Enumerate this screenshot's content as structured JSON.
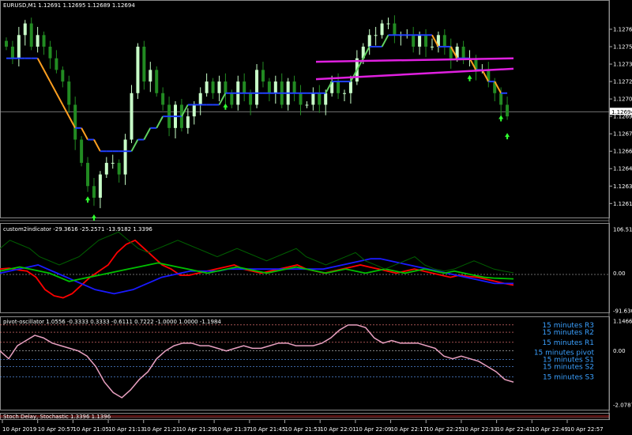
{
  "chart_data": [
    {
      "type": "candlestick",
      "title": "EURUSD,M1  1.12691 1.12695 1.12689 1.12694",
      "y_ticks": [
        "1.12765",
        "1.12750",
        "1.12735",
        "1.12720",
        "1.12705",
        "1.12690",
        "1.12675",
        "1.12660",
        "1.12645",
        "1.12630",
        "1.12615"
      ],
      "ylim": [
        1.12605,
        1.12782
      ],
      "price_label": "1.12694",
      "price_value": 1.12694,
      "closes": [
        1.1275,
        1.1274,
        1.1276,
        1.1277,
        1.1275,
        1.1276,
        1.1275,
        1.1274,
        1.1273,
        1.1272,
        1.127,
        1.1267,
        1.1265,
        1.1263,
        1.1262,
        1.1264,
        1.1265,
        1.1265,
        1.1264,
        1.1267,
        1.1271,
        1.1275,
        1.1272,
        1.1273,
        1.1271,
        1.127,
        1.1268,
        1.127,
        1.1268,
        1.1269,
        1.127,
        1.1271,
        1.1272,
        1.1271,
        1.1272,
        1.1271,
        1.127,
        1.1272,
        1.1271,
        1.127,
        1.1273,
        1.1272,
        1.1271,
        1.1272,
        1.127,
        1.1272,
        1.1271,
        1.127,
        1.127,
        1.1271,
        1.127,
        1.1271,
        1.1272,
        1.1271,
        1.1271,
        1.1272,
        1.1274,
        1.1275,
        1.1276,
        1.1276,
        1.1277,
        1.1277,
        1.1276,
        1.1276,
        1.1276,
        1.1275,
        1.1276,
        1.1275,
        1.1275,
        1.1276,
        1.1275,
        1.1274,
        1.1275,
        1.1274,
        1.1274,
        1.1273,
        1.1273,
        1.1272,
        1.1271,
        1.127,
        1.1269
      ],
      "ma_fast": [
        1.1274,
        1.1274,
        1.1274,
        1.1274,
        1.1274,
        1.1274,
        1.1273,
        1.1272,
        1.1271,
        1.127,
        1.1269,
        1.1268,
        1.1268,
        1.1267,
        1.1267,
        1.1266,
        1.1266,
        1.1266,
        1.1266,
        1.1266,
        1.1266,
        1.1267,
        1.1267,
        1.1268,
        1.1268,
        1.1269,
        1.1269,
        1.1269,
        1.1269,
        1.127,
        1.127,
        1.127,
        1.127,
        1.127,
        1.127,
        1.1271,
        1.1271,
        1.1271,
        1.1271,
        1.1271,
        1.1271,
        1.1271,
        1.1271,
        1.1271,
        1.1271,
        1.1271,
        1.1271,
        1.1271,
        1.1271,
        1.1271,
        1.1271,
        1.1271,
        1.1272,
        1.1272,
        1.1272,
        1.1272,
        1.1273,
        1.1274,
        1.1275,
        1.1275,
        1.1275,
        1.1276,
        1.1276,
        1.1276,
        1.1276,
        1.1276,
        1.1276,
        1.1276,
        1.1276,
        1.1275,
        1.1275,
        1.1275,
        1.1274,
        1.1274,
        1.1274,
        1.1273,
        1.1273,
        1.1272,
        1.1272,
        1.1271,
        1.1271
      ],
      "channel_upper": [
        1.12737,
        1.1274
      ],
      "channel_lower": [
        1.12722,
        1.12731
      ],
      "up_arrows": 6
    },
    {
      "type": "line",
      "title": "custom2indicator -29.3616 -25.2571 -13.9182 1.3396",
      "y_ticks": [
        "106.514",
        "0.00",
        "-91.6304"
      ],
      "ylim": [
        -91.6304,
        106.514
      ],
      "series": [
        {
          "color": "#ff0000",
          "values": [
            10,
            12,
            8,
            5,
            -10,
            -40,
            -55,
            -60,
            -50,
            -30,
            -10,
            5,
            20,
            50,
            70,
            80,
            60,
            40,
            20,
            10,
            -5,
            -5,
            0,
            5,
            10,
            15,
            20,
            10,
            5,
            0,
            5,
            10,
            15,
            20,
            10,
            5,
            0,
            5,
            10,
            15,
            20,
            15,
            10,
            5,
            0,
            5,
            10,
            5,
            0,
            -5,
            -10,
            -5,
            -8,
            -10,
            -15,
            -20,
            -25,
            -29
          ]
        },
        {
          "color": "#1a1aff",
          "values": [
            0,
            5,
            10,
            15,
            20,
            10,
            0,
            -10,
            -20,
            -30,
            -40,
            -45,
            -50,
            -45,
            -40,
            -30,
            -20,
            -10,
            -5,
            0,
            5,
            5,
            5,
            5,
            10,
            10,
            10,
            10,
            10,
            10,
            10,
            10,
            10,
            10,
            10,
            15,
            20,
            25,
            30,
            35,
            35,
            30,
            25,
            20,
            15,
            10,
            5,
            0,
            -5,
            -10,
            -15,
            -20,
            -25,
            -25,
            -25
          ]
        },
        {
          "color": "#00c000",
          "values": [
            5,
            10,
            15,
            10,
            5,
            0,
            -10,
            -20,
            -15,
            -10,
            -5,
            0,
            5,
            10,
            15,
            20,
            25,
            20,
            15,
            10,
            5,
            0,
            5,
            10,
            15,
            10,
            5,
            0,
            5,
            10,
            15,
            10,
            5,
            0,
            5,
            10,
            5,
            0,
            5,
            10,
            5,
            0,
            5,
            10,
            5,
            0,
            5,
            0,
            -5,
            -10,
            -12,
            -13,
            -14
          ]
        },
        {
          "color": "#006000",
          "values": [
            60,
            80,
            70,
            60,
            40,
            30,
            20,
            30,
            40,
            60,
            80,
            90,
            100,
            80,
            60,
            50,
            60,
            70,
            80,
            70,
            60,
            50,
            40,
            50,
            60,
            50,
            40,
            30,
            40,
            50,
            60,
            40,
            30,
            20,
            30,
            40,
            50,
            30,
            20,
            10,
            20,
            30,
            40,
            20,
            10,
            5,
            10,
            20,
            30,
            20,
            10,
            5,
            1
          ]
        }
      ]
    },
    {
      "type": "line",
      "title": "pivot-oscillator 1.0556 -0.3333 0.3333 -0.6111 0.7222 -1.0000 1.0000 -1.1984",
      "y_ticks": [
        "1.1466",
        "0.00",
        "-2.0787"
      ],
      "ylim": [
        -2.0787,
        1.1466
      ],
      "levels": [
        {
          "label": "15 minutes R3",
          "value": 1.0
        },
        {
          "label": "15 minutes R2",
          "value": 0.72
        },
        {
          "label": "15 minutes R1",
          "value": 0.33
        },
        {
          "label": "15 minutes pivot",
          "value": 0.0
        },
        {
          "label": "15 minutes S1",
          "value": -0.33
        },
        {
          "label": "15 minutes S2",
          "value": -0.61
        },
        {
          "label": "15 minutes S3",
          "value": -1.0
        }
      ],
      "values": [
        0.0,
        -0.3,
        0.2,
        0.4,
        0.6,
        0.5,
        0.3,
        0.2,
        0.1,
        0.0,
        -0.2,
        -0.6,
        -1.2,
        -1.6,
        -1.8,
        -1.5,
        -1.1,
        -0.8,
        -0.3,
        0.0,
        0.2,
        0.3,
        0.3,
        0.2,
        0.2,
        0.1,
        0.0,
        0.1,
        0.2,
        0.1,
        0.1,
        0.2,
        0.3,
        0.3,
        0.2,
        0.2,
        0.2,
        0.3,
        0.5,
        0.8,
        1.0,
        1.0,
        0.9,
        0.5,
        0.3,
        0.4,
        0.3,
        0.3,
        0.3,
        0.2,
        0.1,
        -0.2,
        -0.3,
        -0.2,
        -0.3,
        -0.4,
        -0.6,
        -0.8,
        -1.1,
        -1.2
      ]
    },
    {
      "type": "line",
      "title": "Stoch Delay, Stochastic  1.3396  1.1396"
    }
  ],
  "time_axis": [
    "10 Apr 2019",
    "10 Apr 20:57",
    "10 Apr 21:05",
    "10 Apr 21:13",
    "10 Apr 21:21",
    "10 Apr 21:29",
    "10 Apr 21:37",
    "10 Apr 21:45",
    "10 Apr 21:53",
    "10 Apr 22:01",
    "10 Apr 22:09",
    "10 Apr 22:17",
    "10 Apr 22:25",
    "10 Apr 22:33",
    "10 Apr 22:41",
    "10 Apr 22:49",
    "10 Apr 22:57"
  ]
}
